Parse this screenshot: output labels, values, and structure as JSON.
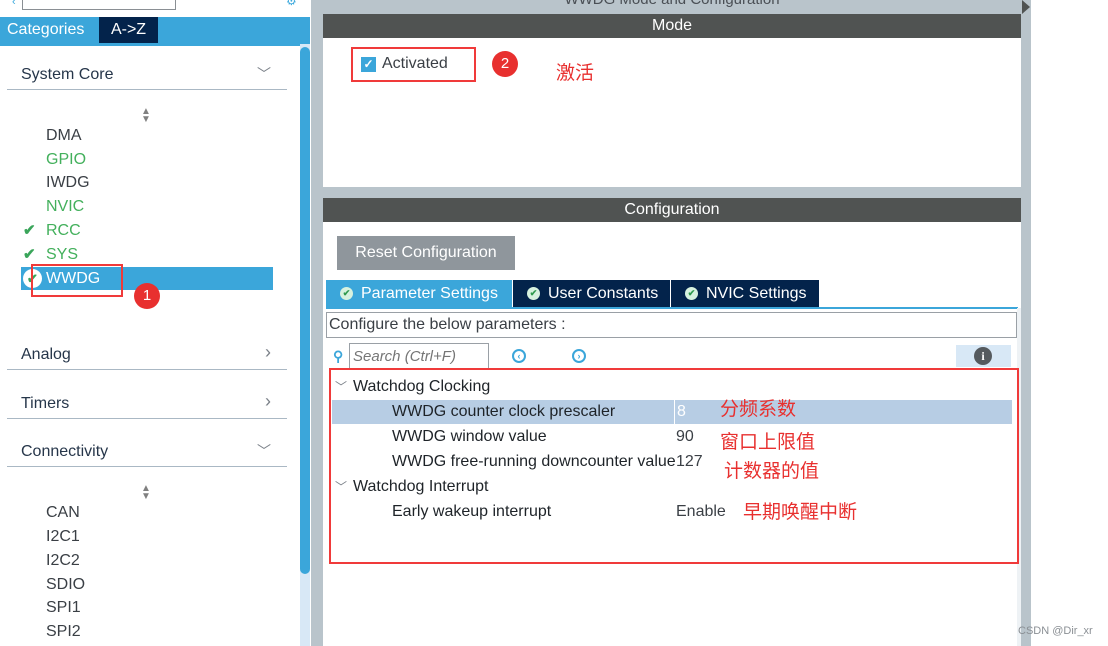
{
  "window": {
    "title": "WWDG Mode and Configuration"
  },
  "left_panel": {
    "tabs": [
      {
        "label": "Categories",
        "active": true
      },
      {
        "label": "A->Z",
        "active": false
      }
    ],
    "sections": [
      {
        "title": "System Core",
        "expanded": true,
        "items": [
          {
            "label": "DMA",
            "status": "none"
          },
          {
            "label": "GPIO",
            "status": "configured"
          },
          {
            "label": "IWDG",
            "status": "none"
          },
          {
            "label": "NVIC",
            "status": "configured"
          },
          {
            "label": "RCC",
            "status": "checked"
          },
          {
            "label": "SYS",
            "status": "checked"
          },
          {
            "label": "WWDG",
            "status": "selected"
          }
        ]
      },
      {
        "title": "Analog",
        "expanded": false
      },
      {
        "title": "Timers",
        "expanded": false
      },
      {
        "title": "Connectivity",
        "expanded": true,
        "items": [
          {
            "label": "CAN"
          },
          {
            "label": "I2C1"
          },
          {
            "label": "I2C2"
          },
          {
            "label": "SDIO"
          },
          {
            "label": "SPI1"
          },
          {
            "label": "SPI2"
          }
        ]
      }
    ]
  },
  "mode": {
    "header": "Mode",
    "activated_label": "Activated",
    "activated_checked": true
  },
  "configuration": {
    "header": "Configuration",
    "reset_button": "Reset Configuration",
    "tabs": [
      {
        "label": "Parameter Settings",
        "active": true
      },
      {
        "label": "User Constants",
        "active": false
      },
      {
        "label": "NVIC Settings",
        "active": false
      }
    ],
    "description": "Configure the below parameters :",
    "search_placeholder": "Search (Ctrl+F)",
    "groups": [
      {
        "title": "Watchdog Clocking",
        "params": [
          {
            "name": "WWDG counter clock prescaler",
            "value": "8",
            "selected": true
          },
          {
            "name": "WWDG window value",
            "value": "90"
          },
          {
            "name": "WWDG free-running downcounter value",
            "value": "127"
          }
        ]
      },
      {
        "title": "Watchdog Interrupt",
        "params": [
          {
            "name": "Early wakeup interrupt",
            "value": "Enable"
          }
        ]
      }
    ]
  },
  "annotations": {
    "step1": "1",
    "step2": "2",
    "activate_note": "激活",
    "prescaler_note": "分频系数",
    "window_note": "窗口上限值",
    "counter_note": "计数器的值",
    "ewi_note": "早期唤醒中断",
    "color": "#e8302f"
  },
  "watermark": "CSDN @Dir_xr",
  "icons": {
    "check": "✔",
    "chevron_down": "﹀",
    "chevron_right": "›",
    "sort": "▲▼",
    "search": "⚲",
    "prev": "‹",
    "next": "›",
    "info": "i"
  }
}
